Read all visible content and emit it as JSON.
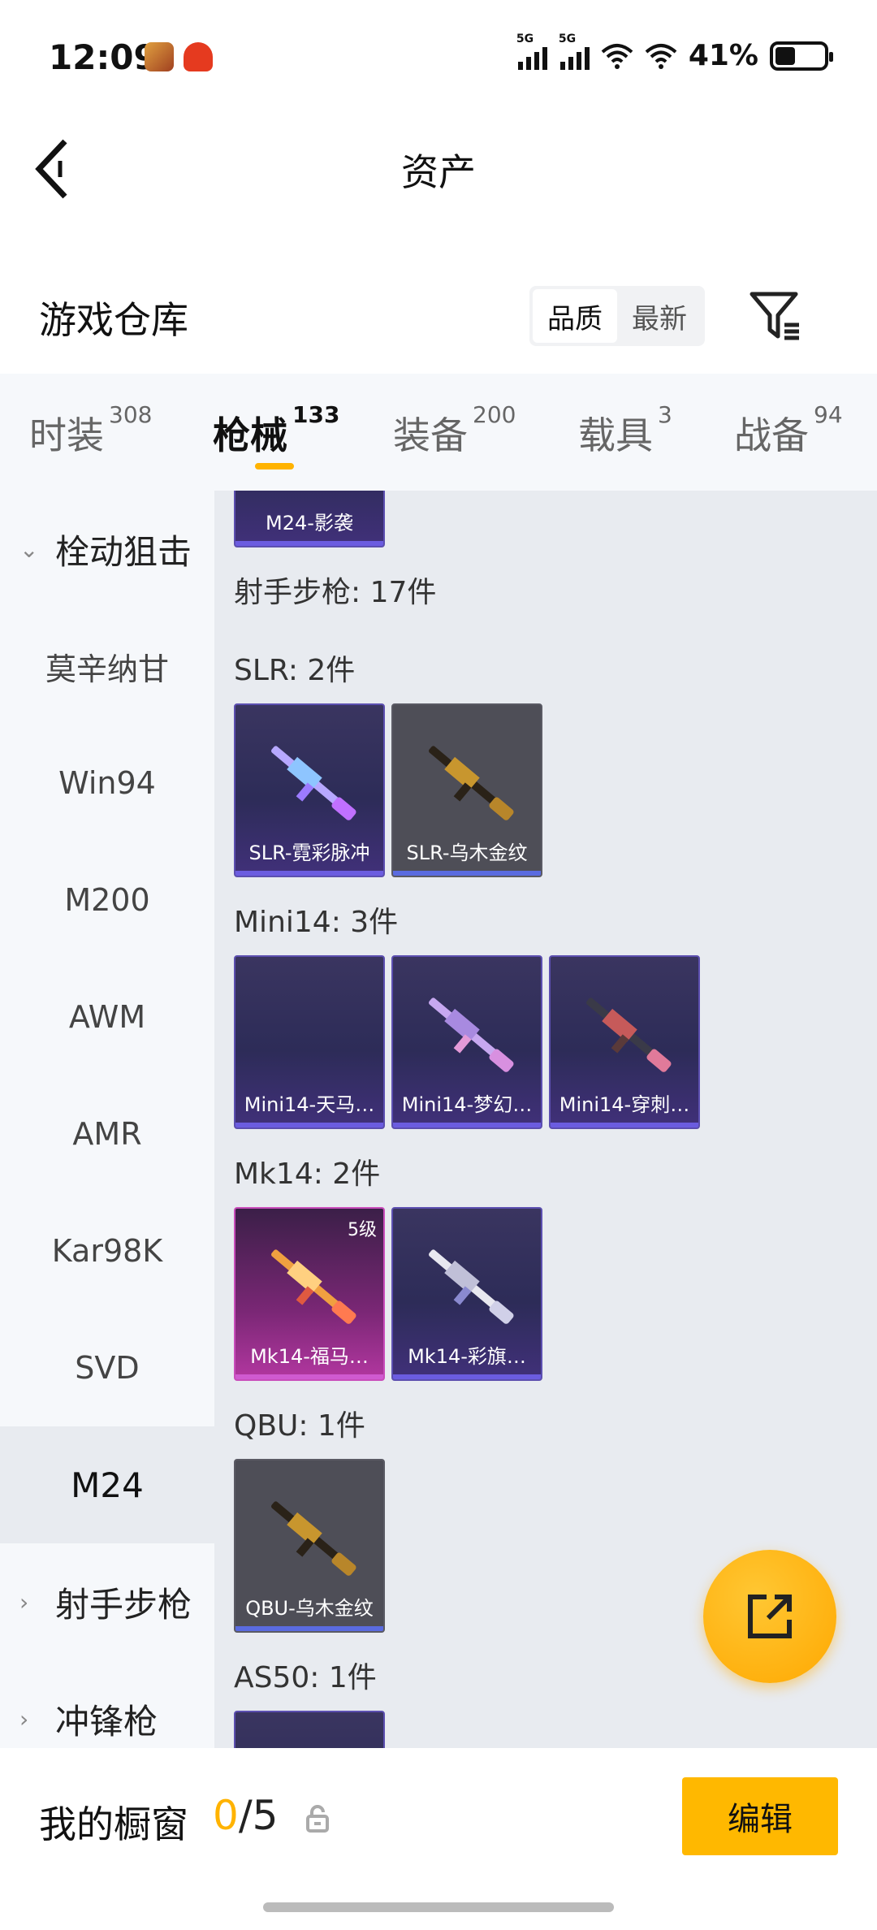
{
  "status_bar": {
    "time": "12:09",
    "battery": "41%",
    "battery_level": 0.41,
    "network1": "5G",
    "network2": "5G",
    "icons": [
      "game-avatar-icon",
      "robot-app-icon",
      "signal-icon",
      "signal-icon",
      "wifi-icon",
      "wifi-icon",
      "battery-icon"
    ]
  },
  "header": {
    "title": "资产"
  },
  "warehouse": {
    "title": "游戏仓库",
    "sort_options": [
      "品质",
      "最新"
    ],
    "active_sort": "品质"
  },
  "tabs": [
    {
      "label": "时装",
      "count": "308"
    },
    {
      "label": "枪械",
      "count": "133",
      "active": true
    },
    {
      "label": "装备",
      "count": "200"
    },
    {
      "label": "载具",
      "count": "3"
    },
    {
      "label": "战备",
      "count": "94"
    }
  ],
  "sidenav": {
    "group_open": "栓动狙击",
    "items": [
      "莫辛纳甘",
      "Win94",
      "M200",
      "AWM",
      "AMR",
      "Kar98K",
      "SVD",
      "M24"
    ],
    "active_item": "M24",
    "group_closed_1": "射手步枪",
    "group_closed_2": "冲锋枪"
  },
  "content": {
    "top_card": "M24-影袭",
    "category_title": "射手步枪: 17件",
    "sections": [
      {
        "title": "SLR: 2件",
        "cards": [
          "SLR-霓彩脉冲",
          "SLR-乌木金纹"
        ]
      },
      {
        "title": "Mini14: 3件",
        "cards": [
          "Mini14-天马…",
          "Mini14-梦幻…",
          "Mini14-穿刺…"
        ]
      },
      {
        "title": "Mk14: 2件",
        "cards": [
          "Mk14-福马…",
          "Mk14-彩旗…"
        ],
        "level_badge": "5级"
      },
      {
        "title": "QBU: 1件",
        "cards": [
          "QBU-乌木金纹"
        ]
      },
      {
        "title": "AS50: 1件"
      }
    ]
  },
  "showcase": {
    "title": "我的橱窗",
    "used": "0",
    "total": "/5",
    "edit_label": "编辑"
  },
  "colors": {
    "accent": "#ffb300"
  }
}
